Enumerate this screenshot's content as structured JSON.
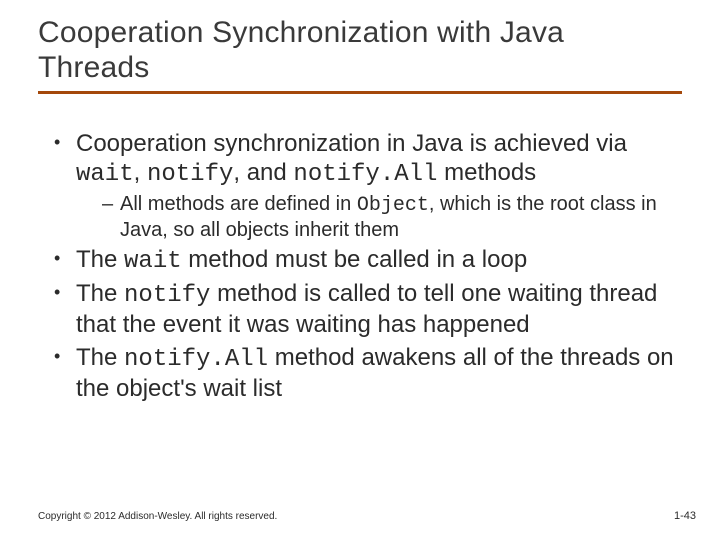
{
  "title": "Cooperation Synchronization with Java Threads",
  "bullets": {
    "b1_pre": "Cooperation synchronization in Java is achieved via ",
    "b1_c1": "wait",
    "b1_m1": ", ",
    "b1_c2": "notify",
    "b1_m2": ", and ",
    "b1_c3": "notify.All",
    "b1_post": " methods",
    "b1_sub_pre": "All methods are defined in ",
    "b1_sub_code": "Object",
    "b1_sub_post": ", which is the root class in Java, so all objects inherit them",
    "b2_pre": "The ",
    "b2_code": "wait",
    "b2_post": " method must be called in a loop",
    "b3_pre": "The ",
    "b3_code": "notify",
    "b3_post": " method is called to tell one waiting thread that the event it was waiting has happened",
    "b4_pre": "The ",
    "b4_code": "notify.All",
    "b4_post": " method awakens all of the threads on the object's wait list"
  },
  "footer": {
    "copyright": "Copyright © 2012 Addison-Wesley. All rights reserved.",
    "page": "1-43"
  }
}
